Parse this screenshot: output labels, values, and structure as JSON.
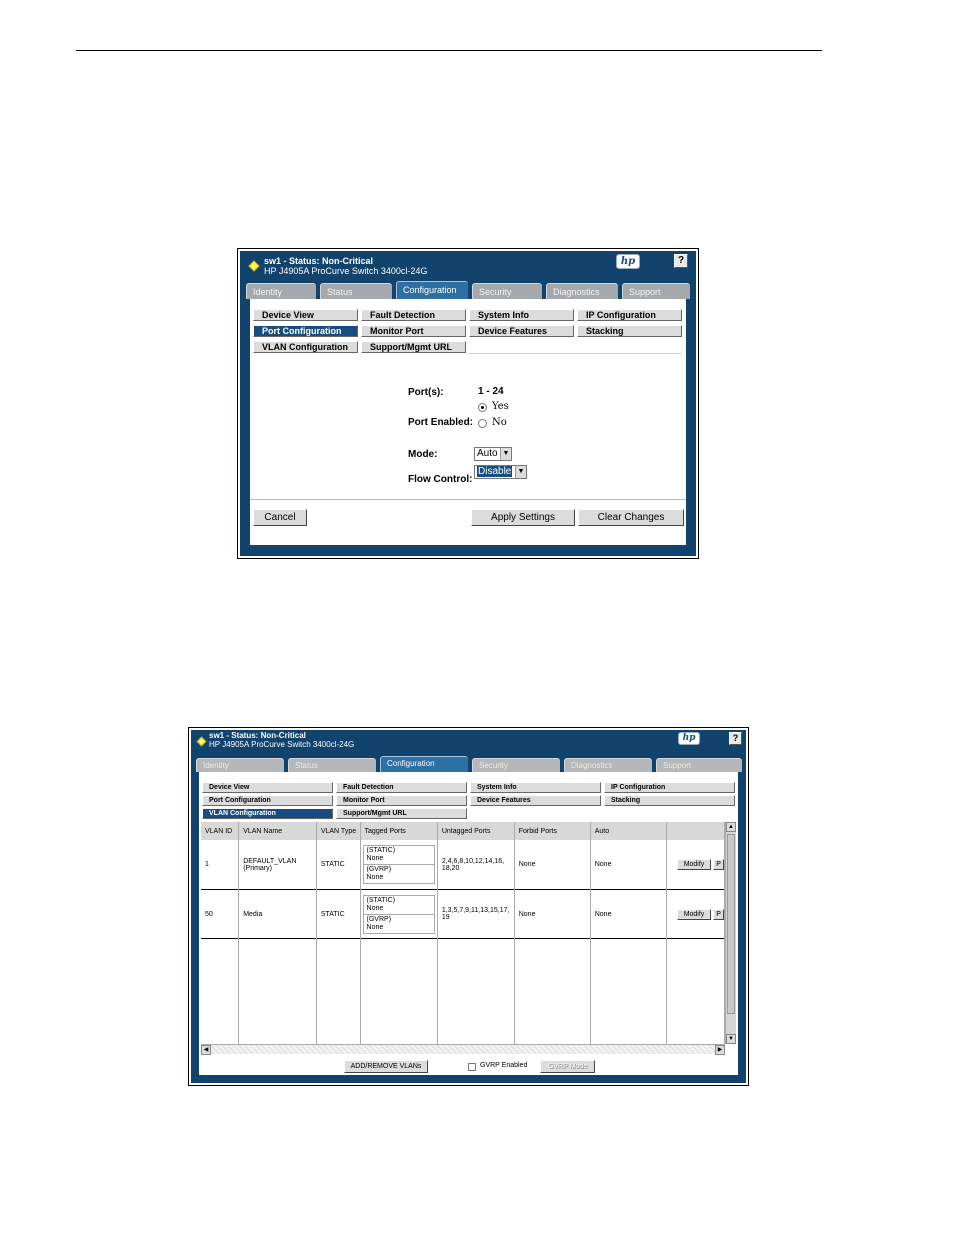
{
  "shot1": {
    "title": {
      "status_line": "sw1 - Status: Non-Critical",
      "model_line": "HP J4905A ProCurve Switch 3400cl-24G"
    },
    "logo_text": "hp",
    "help_label": "?",
    "tabs": [
      "Identity",
      "Status",
      "Configuration",
      "Security",
      "Diagnostics",
      "Support"
    ],
    "active_tab": "Configuration",
    "subnav": {
      "device_view": "Device View",
      "fault_detection": "Fault Detection",
      "system_info": "System Info",
      "ip_configuration": "IP Configuration",
      "port_configuration": "Port Configuration",
      "monitor_port": "Monitor Port",
      "device_features": "Device Features",
      "stacking": "Stacking",
      "vlan_configuration": "VLAN Configuration",
      "support_mgmt_url": "Support/Mgmt URL"
    },
    "form": {
      "ports_label": "Port(s):",
      "ports_value": "1 - 24",
      "port_enabled_label": "Port Enabled:",
      "yes_label": "Yes",
      "no_label": "No",
      "mode_label": "Mode:",
      "mode_value": "Auto",
      "flow_control_label": "Flow Control:",
      "flow_control_value": "Disable"
    },
    "buttons": {
      "cancel": "Cancel",
      "apply": "Apply Settings",
      "clear": "Clear Changes"
    }
  },
  "shot2": {
    "title": {
      "status_line": "sw1 - Status: Non-Critical",
      "model_line": "HP J4905A ProCurve Switch 3400cl-24G"
    },
    "logo_text": "hp",
    "help_label": "?",
    "tabs": [
      "Identity",
      "Status",
      "Configuration",
      "Security",
      "Diagnostics",
      "Support"
    ],
    "active_tab": "Configuration",
    "subnav": {
      "device_view": "Device View",
      "fault_detection": "Fault Detection",
      "system_info": "System Info",
      "ip_configuration": "IP Configuration",
      "port_configuration": "Port Configuration",
      "monitor_port": "Monitor Port",
      "device_features": "Device Features",
      "stacking": "Stacking",
      "vlan_configuration": "VLAN Configuration",
      "support_mgmt_url": "Support/Mgmt URL"
    },
    "table": {
      "headers": [
        "VLAN ID",
        "VLAN Name",
        "VLAN Type",
        "Tagged Ports",
        "Untagged Ports",
        "Forbid Ports",
        "Auto"
      ],
      "rows": [
        {
          "vlan_id": "1",
          "vlan_name": "DEFAULT_VLAN",
          "vlan_name_sub": "(Primary)",
          "vlan_type": "STATIC",
          "tagged_static_label": "(STATIC)",
          "tagged_static_value": "None",
          "tagged_gvrp_label": "(GVRP)",
          "tagged_gvrp_value": "None",
          "untagged": "2,4,6,8,10,12,14,16,",
          "untagged_cont": "18,20",
          "forbid": "None",
          "auto": "None",
          "modify": "Modify",
          "action2": "P"
        },
        {
          "vlan_id": "50",
          "vlan_name": "Media",
          "vlan_name_sub": "",
          "vlan_type": "STATIC",
          "tagged_static_label": "(STATIC)",
          "tagged_static_value": "None",
          "tagged_gvrp_label": "(GVRP)",
          "tagged_gvrp_value": "None",
          "untagged": "1,3,5,7,9,11,13,15,17,",
          "untagged_cont": "19",
          "forbid": "None",
          "auto": "None",
          "modify": "Modify",
          "action2": "P"
        }
      ]
    },
    "footer": {
      "add_remove": "ADD/REMOVE VLANs",
      "gvrp_enabled": "GVRP Enabled",
      "gvrp_mode": "GVRP Mode"
    }
  },
  "colors": {
    "frame_navy": "#12436c",
    "active_tab": "#2e6fa4",
    "active_subnav": "#174d80",
    "status_diamond": "#fff36b"
  }
}
